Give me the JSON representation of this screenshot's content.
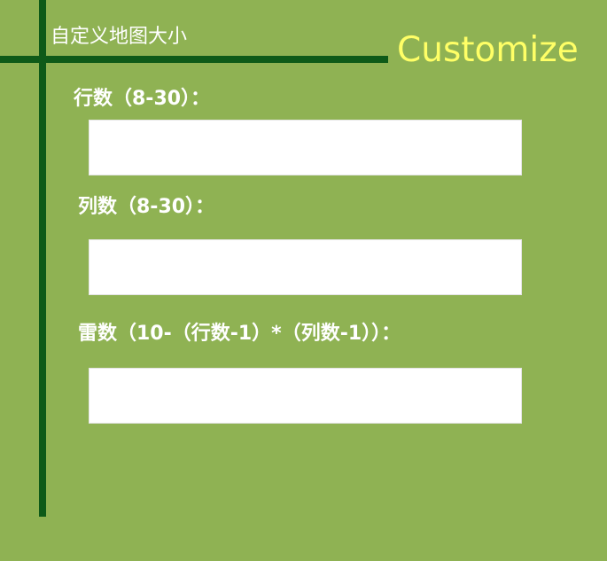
{
  "header": {
    "title": "自定义地图大小",
    "brand": "Customize"
  },
  "form": {
    "rows_label": "行数（8-30）：",
    "cols_label": "列数（8-30）：",
    "mines_label": "雷数（10-（行数-1）*（列数-1））：",
    "rows_value": "",
    "cols_value": "",
    "mines_value": ""
  },
  "colors": {
    "background": "#8fb253",
    "lines": "#0e5a18",
    "brand": "#ffff66",
    "text": "#ffffff"
  }
}
